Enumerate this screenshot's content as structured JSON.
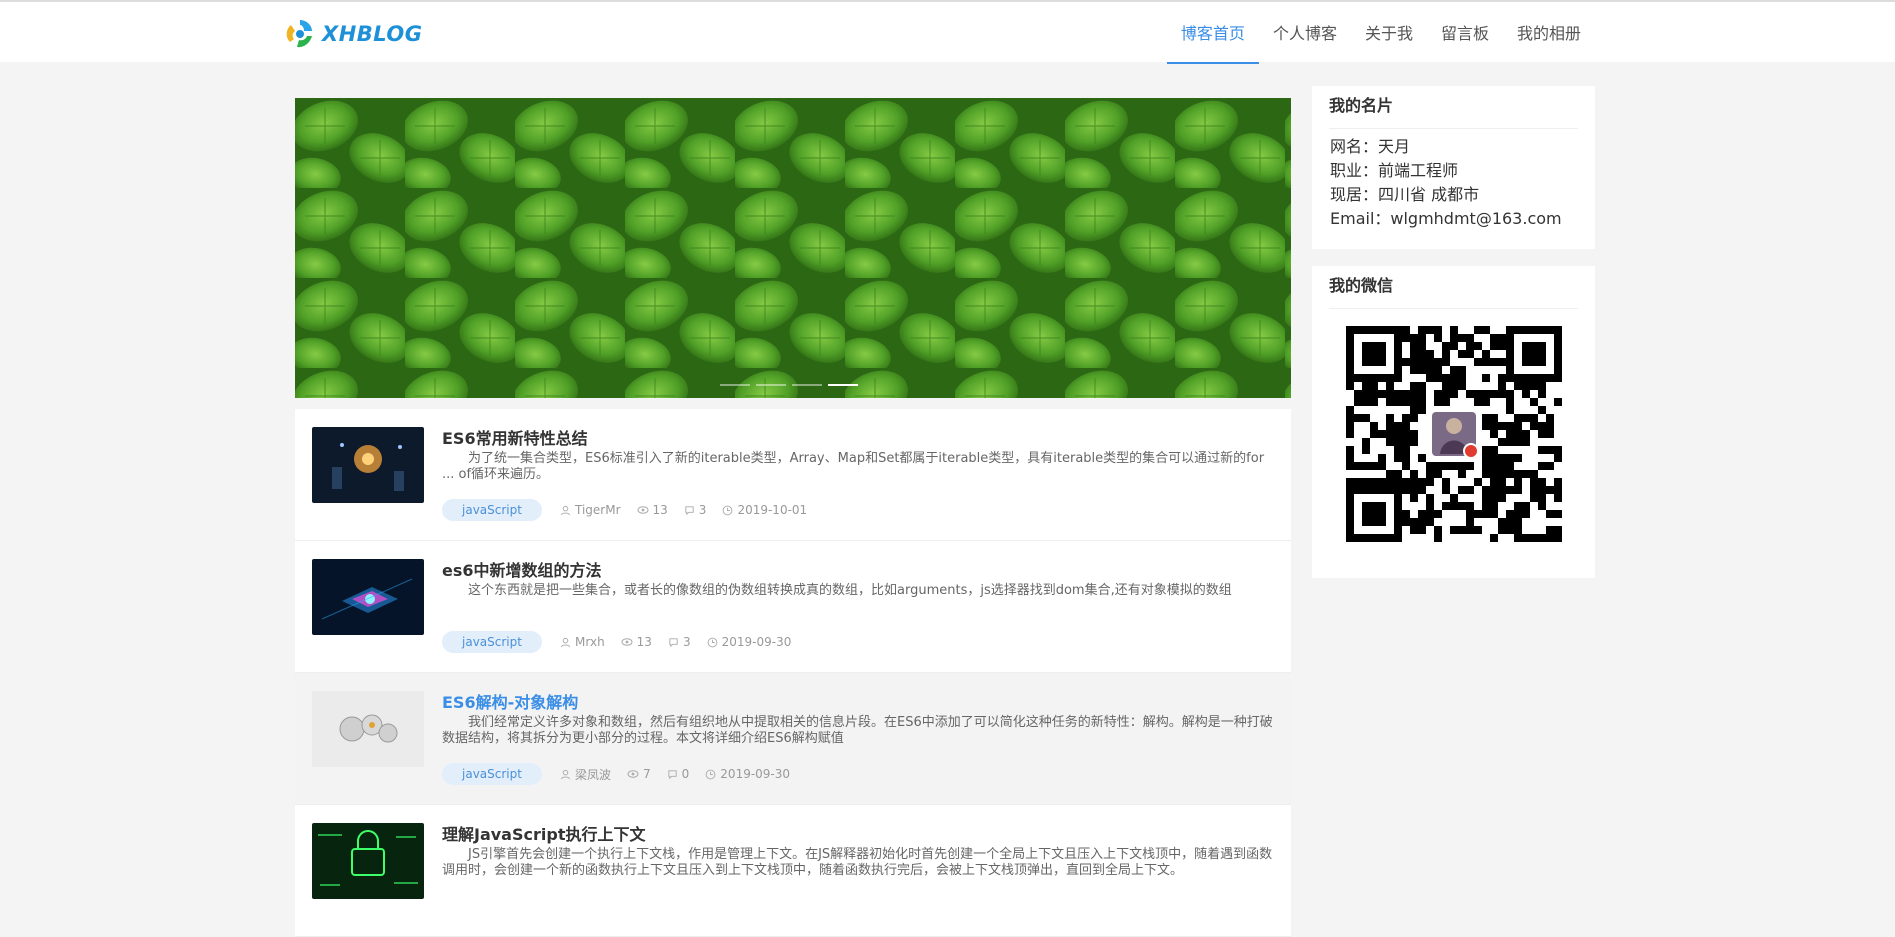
{
  "brand": {
    "name": "XHBLOG"
  },
  "nav": [
    {
      "label": "博客首页",
      "active": true
    },
    {
      "label": "个人博客",
      "active": false
    },
    {
      "label": "关于我",
      "active": false
    },
    {
      "label": "留言板",
      "active": false
    },
    {
      "label": "我的相册",
      "active": false
    }
  ],
  "banner": {
    "slides": 4,
    "current": 4
  },
  "articles": [
    {
      "title": "ES6常用新特性总结",
      "desc": "为了统一集合类型，ES6标准引入了新的iterable类型，Array、Map和Set都属于iterable类型，具有iterable类型的集合可以通过新的for ... of循环来遍历。",
      "tag": "javaScript",
      "author": "TigerMr",
      "views": "13",
      "comments": "3",
      "date": "2019-10-01"
    },
    {
      "title": "es6中新增数组的方法",
      "desc": "这个东西就是把一些集合，或者长的像数组的伪数组转换成真的数组，比如arguments，js选择器找到dom集合,还有对象模拟的数组",
      "tag": "javaScript",
      "author": "Mrxh",
      "views": "13",
      "comments": "3",
      "date": "2019-09-30"
    },
    {
      "title": "ES6解构-对象解构",
      "desc": "我们经常定义许多对象和数组，然后有组织地从中提取相关的信息片段。在ES6中添加了可以简化这种任务的新特性：解构。解构是一种打破数据结构，将其拆分为更小部分的过程。本文将详细介绍ES6解构赋值",
      "tag": "javaScript",
      "author": "梁凤波",
      "views": "7",
      "comments": "0",
      "date": "2019-09-30"
    },
    {
      "title": "理解JavaScript执行上下文",
      "desc": "JS引擎首先会创建一个执行上下文栈，作用是管理上下文。在JS解释器初始化时首先创建一个全局上下文且压入上下文栈顶中，随着遇到函数调用时，会创建一个新的函数执行上下文且压入到上下文栈顶中，随着函数执行完后，会被上下文栈顶弹出，直回到全局上下文。"
    }
  ],
  "card": {
    "title": "我的名片",
    "name": "网名：天月",
    "job": "职业：前端工程师",
    "location": "现居：四川省 成都市",
    "email": "Email：wlgmhdmt@163.com"
  },
  "wechat": {
    "title": "我的微信"
  },
  "colors": {
    "accent": "#3a8ee6",
    "tag_bg": "#e3eefb",
    "page_bg": "#f4f4f4"
  }
}
